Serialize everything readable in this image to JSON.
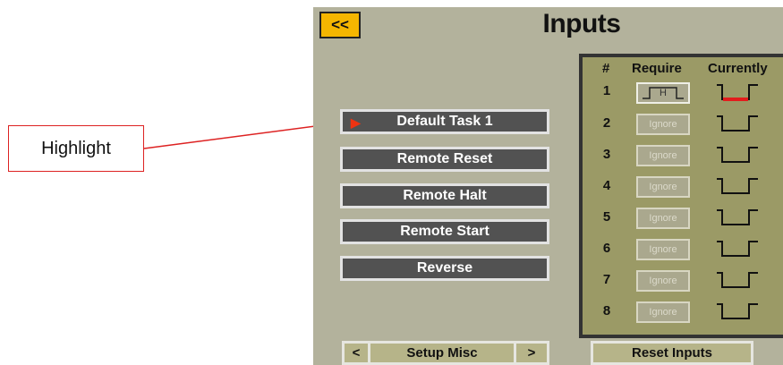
{
  "annotation": {
    "label": "Highlight",
    "color": "#dd2222"
  },
  "screen": {
    "back_label": "<<",
    "title": "Inputs",
    "menu": [
      {
        "label": "Default Task 1",
        "highlighted": true
      },
      {
        "label": "Remote Reset",
        "highlighted": false
      },
      {
        "label": "Remote Halt",
        "highlighted": false
      },
      {
        "label": "Remote Start",
        "highlighted": false
      },
      {
        "label": "Reverse",
        "highlighted": false
      }
    ],
    "inputs": {
      "headers": {
        "num": "#",
        "require": "Require",
        "currently": "Currently"
      },
      "rows": [
        {
          "num": "1",
          "require": "H",
          "current_state": "low-active"
        },
        {
          "num": "2",
          "require": "Ignore",
          "current_state": "low"
        },
        {
          "num": "3",
          "require": "Ignore",
          "current_state": "low"
        },
        {
          "num": "4",
          "require": "Ignore",
          "current_state": "low"
        },
        {
          "num": "5",
          "require": "Ignore",
          "current_state": "low"
        },
        {
          "num": "6",
          "require": "Ignore",
          "current_state": "low"
        },
        {
          "num": "7",
          "require": "Ignore",
          "current_state": "low"
        },
        {
          "num": "8",
          "require": "Ignore",
          "current_state": "low"
        }
      ]
    },
    "nav": {
      "prev": "<",
      "label": "Setup Misc",
      "next": ">"
    },
    "reset_label": "Reset Inputs",
    "colors": {
      "background": "#b3b29c",
      "panel": "#9b9a66",
      "button": "#525252",
      "accent": "#f5b600",
      "active_state": "#e31c1c"
    }
  }
}
